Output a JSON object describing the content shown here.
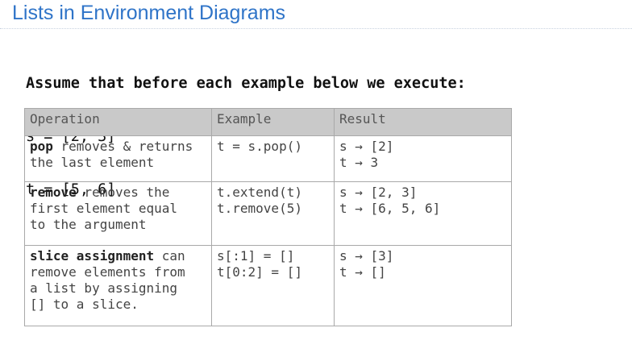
{
  "title": "Lists in Environment Diagrams",
  "intro": {
    "heading": "Assume that before each example below we execute:",
    "lines": [
      "s = [2, 3]",
      "t = [5, 6]"
    ]
  },
  "table": {
    "headers": [
      "Operation",
      "Example",
      "Result"
    ],
    "rows": [
      {
        "keyword": "pop",
        "description_lines": [
          " removes & returns",
          "the last element"
        ],
        "example_lines": [
          "t = s.pop()"
        ],
        "result_lines": [
          "s → [2]",
          "t → 3"
        ]
      },
      {
        "keyword": "remove",
        "description_lines": [
          " removes the",
          "first element equal",
          "to the argument"
        ],
        "example_lines": [
          "t.extend(t)",
          "t.remove(5)"
        ],
        "result_lines": [
          "s → [2, 3]",
          "t → [6, 5, 6]"
        ]
      },
      {
        "keyword": "slice assignment",
        "description_lines": [
          " can",
          "remove elements from",
          "a list by assigning",
          "[] to a slice."
        ],
        "example_lines": [
          "s[:1] = []",
          "t[0:2] = []"
        ],
        "result_lines": [
          "s → [3]",
          "t → []"
        ]
      }
    ]
  }
}
